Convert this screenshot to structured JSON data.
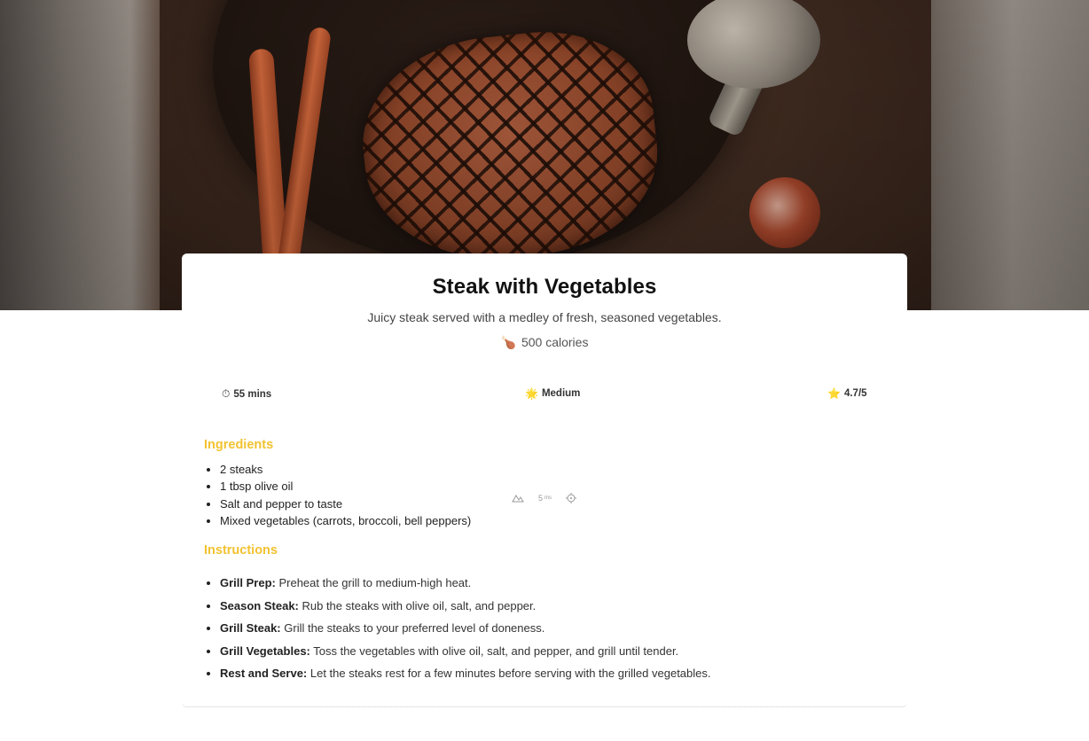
{
  "recipe": {
    "title": "Steak with Vegetables",
    "description": "Juicy steak served with a medley of fresh, seasoned vegetables.",
    "calories_icon": "🍗",
    "calories": "500 calories",
    "meta": {
      "time_icon": "⏱",
      "time": "55 mins",
      "difficulty_icon": "🌟",
      "difficulty": "Medium",
      "rating_icon": "⭐",
      "rating": "4.7/5"
    },
    "ingredients_heading": "Ingredients",
    "ingredients": [
      "2 steaks",
      "1 tbsp olive oil",
      "Salt and pepper to taste",
      "Mixed vegetables (carrots, broccoli, bell peppers)"
    ],
    "instructions_heading": "Instructions",
    "instructions": [
      {
        "step": "Grill Prep:",
        "text": " Preheat the grill to medium-high heat."
      },
      {
        "step": "Season Steak:",
        "text": " Rub the steaks with olive oil, salt, and pepper."
      },
      {
        "step": "Grill Steak:",
        "text": " Grill the steaks to your preferred level of doneness."
      },
      {
        "step": "Grill Vegetables:",
        "text": " Toss the vegetables with olive oil, salt, and pepper, and grill until tender."
      },
      {
        "step": "Rest and Serve:",
        "text": " Let the steaks rest for a few minutes before serving with the grilled vegetables."
      }
    ]
  },
  "mini_toolbar": {
    "value": "5",
    "unit": "ms"
  },
  "colors": {
    "accent": "#f2c230"
  }
}
